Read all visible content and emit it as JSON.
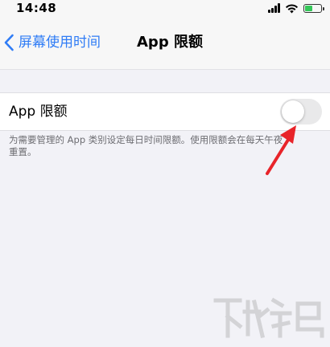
{
  "status_bar": {
    "time": "14:48",
    "icons": [
      "cellular-signal-icon",
      "wifi-icon",
      "battery-icon"
    ],
    "battery_color": "#34c759"
  },
  "nav": {
    "back_label": "屏幕使用时间",
    "back_icon": "chevron-left-icon",
    "title": "App 限额"
  },
  "settings": {
    "app_limits_label": "App 限额",
    "app_limits_enabled": false,
    "footer": "为需要管理的 App 类别设定每日时间限额。使用限额会在每天午夜重置。"
  },
  "colors": {
    "accent": "#2f7cf6",
    "annotation_arrow": "#e8242a"
  },
  "annotation": {
    "icon": "red-arrow-icon"
  },
  "watermark": {
    "icon": "site-logo-watermark"
  }
}
